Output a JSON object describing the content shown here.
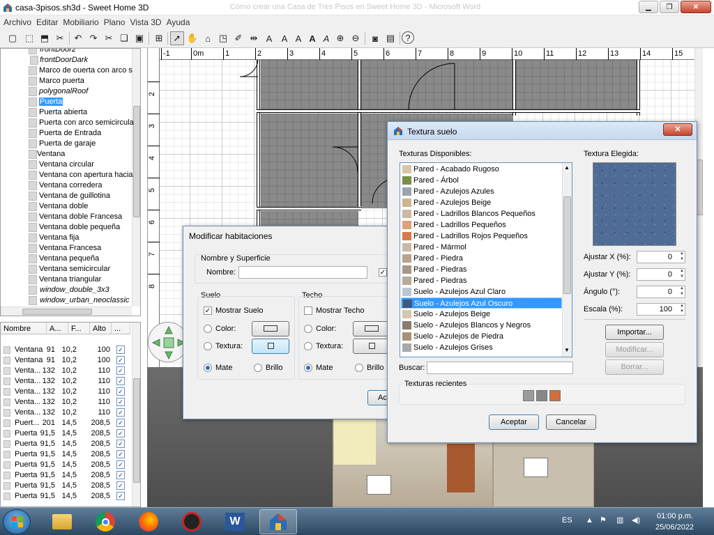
{
  "window": {
    "title": "casa-3pisos.sh3d - Sweet Home 3D",
    "ghost_title": "Cómo crear una Casa de Tres Pisos en Sweet Home 3D - Microsoft Word"
  },
  "menu": [
    "Archivo",
    "Editar",
    "Mobiliario",
    "Plano",
    "Vista 3D",
    "Ayuda"
  ],
  "catalog": {
    "items": [
      {
        "label": "frontDoor2",
        "italic": true
      },
      {
        "label": "frontDoorDark",
        "italic": true
      },
      {
        "label": "Marco de ouerta con arco s",
        "italic": false
      },
      {
        "label": "Marco puerta",
        "italic": false
      },
      {
        "label": "polygonalRoof",
        "italic": true
      },
      {
        "label": "Puerta",
        "italic": false,
        "selected": true
      },
      {
        "label": "Puerta abierta",
        "italic": false
      },
      {
        "label": "Puerta con arco semicircula",
        "italic": false
      },
      {
        "label": "Puerta de Entrada",
        "italic": false
      },
      {
        "label": "Puerta de garaje",
        "italic": false
      },
      {
        "label": "Ventana",
        "italic": false
      },
      {
        "label": "Ventana circular",
        "italic": false
      },
      {
        "label": "Ventana con apertura hacia",
        "italic": false
      },
      {
        "label": "Ventana corredera",
        "italic": false
      },
      {
        "label": "Ventana de guillotina",
        "italic": false
      },
      {
        "label": "Ventana doble",
        "italic": false
      },
      {
        "label": "Ventana doble Francesa",
        "italic": false
      },
      {
        "label": "Ventana doble pequeña",
        "italic": false
      },
      {
        "label": "Ventana fija",
        "italic": false
      },
      {
        "label": "Ventana Francesa",
        "italic": false
      },
      {
        "label": "Ventana pequeña",
        "italic": false
      },
      {
        "label": "Ventana semicircular",
        "italic": false
      },
      {
        "label": "Ventana triangular",
        "italic": false
      },
      {
        "label": "window_double_3x3",
        "italic": true
      },
      {
        "label": "window_urban_neoclassic",
        "italic": true
      }
    ]
  },
  "furniture": {
    "headers": [
      "Nombre",
      "A...",
      "F...",
      "Alto",
      "..."
    ],
    "rows": [
      [
        "Ventana",
        "91",
        "10,2",
        "100"
      ],
      [
        "Ventana",
        "91",
        "10,2",
        "100"
      ],
      [
        "Venta...",
        "132",
        "10,2",
        "110"
      ],
      [
        "Venta...",
        "132",
        "10,2",
        "110"
      ],
      [
        "Venta...",
        "132",
        "10,2",
        "110"
      ],
      [
        "Venta...",
        "132",
        "10,2",
        "110"
      ],
      [
        "Venta...",
        "132",
        "10,2",
        "110"
      ],
      [
        "Puert...",
        "201",
        "14,5",
        "208,5"
      ],
      [
        "Puerta",
        "91,5",
        "14,5",
        "208,5"
      ],
      [
        "Puerta",
        "91,5",
        "14,5",
        "208,5"
      ],
      [
        "Puerta",
        "91,5",
        "14,5",
        "208,5"
      ],
      [
        "Puerta",
        "91,5",
        "14,5",
        "208,5"
      ],
      [
        "Puerta",
        "91,5",
        "14,5",
        "208,5"
      ],
      [
        "Puerta",
        "91,5",
        "14,5",
        "208,5"
      ],
      [
        "Puerta",
        "91,5",
        "14,5",
        "208,5"
      ]
    ],
    "check": "✓"
  },
  "ruler": {
    "h": [
      "-1",
      "0m",
      "1",
      "2",
      "3",
      "4",
      "5",
      "6",
      "7",
      "8",
      "9",
      "10",
      "11",
      "12",
      "13",
      "14",
      "15"
    ],
    "v": [
      "2",
      "3",
      "4",
      "5",
      "6",
      "7",
      "8"
    ]
  },
  "rooms_dialog": {
    "title": "Modificar habitaciones",
    "name_group": "Nombre y Superficie",
    "name_label": "Nombre:",
    "floor_group": "Suelo",
    "ceiling_group": "Techo",
    "show_floor": "Mostrar Suelo",
    "show_ceiling": "Mostrar Techo",
    "color": "Color:",
    "texture": "Textura:",
    "matte": "Mate",
    "gloss": "Brillo",
    "accept_partial": "Ac"
  },
  "texture_dialog": {
    "title": "Textura suelo",
    "available_label": "Texturas Disponibles:",
    "chosen_label": "Textura Elegida:",
    "textures": [
      {
        "name": "Pared - Acabado Rugoso",
        "color": "#d9c5a6"
      },
      {
        "name": "Pared - Árbol",
        "color": "#7a8f46"
      },
      {
        "name": "Pared - Azulejos Azules",
        "color": "#9aa4ae"
      },
      {
        "name": "Pared - Azulejos Beige",
        "color": "#cdb58f"
      },
      {
        "name": "Pared - Ladrillos Blancos Pequeños",
        "color": "#c8b9a5"
      },
      {
        "name": "Pared - Ladrillos Pequeños",
        "color": "#e0a07a"
      },
      {
        "name": "Pared - Ladrillos Rojos Pequeños",
        "color": "#d97a4c"
      },
      {
        "name": "Pared - Mármol",
        "color": "#c9b9a4"
      },
      {
        "name": "Pared - Piedra",
        "color": "#b8a28a"
      },
      {
        "name": "Pared - Piedras",
        "color": "#a59886"
      },
      {
        "name": "Pared - Piedras",
        "color": "#b7ab98"
      },
      {
        "name": "Suelo - Azulejos Azul Claro",
        "color": "#bcc6d3"
      },
      {
        "name": "Suelo - Azulejos Azul Oscuro",
        "color": "#3f5a82",
        "selected": true
      },
      {
        "name": "Suelo - Azulejos Beige",
        "color": "#d4c7ab"
      },
      {
        "name": "Suelo - Azulejos Blancos y Negros",
        "color": "#8a7b6c"
      },
      {
        "name": "Suelo - Azulejos de Piedra",
        "color": "#a99177"
      },
      {
        "name": "Suelo - Azulejos Grises",
        "color": "#a7a9ad"
      }
    ],
    "adjust_x_label": "Ajustar X (%):",
    "adjust_x": "0",
    "adjust_y_label": "Ajustar Y (%):",
    "adjust_y": "0",
    "angle_label": "Ángulo (°):",
    "angle": "0",
    "scale_label": "Escala (%):",
    "scale": "100",
    "import": "Importar...",
    "modify": "Modificar...",
    "delete": "Borrar...",
    "search_label": "Buscar:",
    "recent_label": "Texturas recientes",
    "recent_colors": [
      "#9b9b9b",
      "#878787",
      "#cf6e3e"
    ],
    "accept": "Aceptar",
    "cancel": "Cancelar"
  },
  "taskbar": {
    "lang": "ES",
    "time": "01:00 p.m.",
    "date": "25/06/2022"
  }
}
